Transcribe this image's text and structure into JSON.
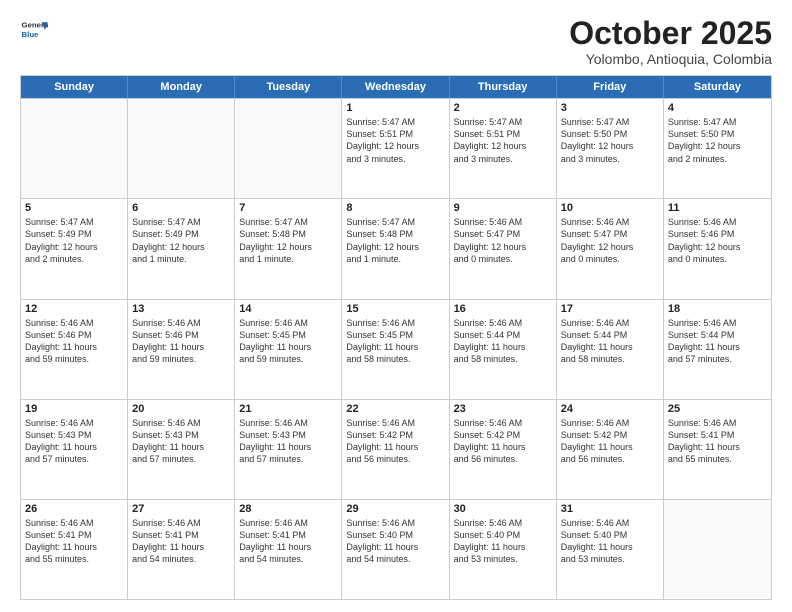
{
  "logo": {
    "general": "General",
    "blue": "Blue"
  },
  "header": {
    "month": "October 2025",
    "location": "Yolombo, Antioquia, Colombia"
  },
  "weekdays": [
    "Sunday",
    "Monday",
    "Tuesday",
    "Wednesday",
    "Thursday",
    "Friday",
    "Saturday"
  ],
  "rows": [
    [
      {
        "day": "",
        "info": ""
      },
      {
        "day": "",
        "info": ""
      },
      {
        "day": "",
        "info": ""
      },
      {
        "day": "1",
        "info": "Sunrise: 5:47 AM\nSunset: 5:51 PM\nDaylight: 12 hours\nand 3 minutes."
      },
      {
        "day": "2",
        "info": "Sunrise: 5:47 AM\nSunset: 5:51 PM\nDaylight: 12 hours\nand 3 minutes."
      },
      {
        "day": "3",
        "info": "Sunrise: 5:47 AM\nSunset: 5:50 PM\nDaylight: 12 hours\nand 3 minutes."
      },
      {
        "day": "4",
        "info": "Sunrise: 5:47 AM\nSunset: 5:50 PM\nDaylight: 12 hours\nand 2 minutes."
      }
    ],
    [
      {
        "day": "5",
        "info": "Sunrise: 5:47 AM\nSunset: 5:49 PM\nDaylight: 12 hours\nand 2 minutes."
      },
      {
        "day": "6",
        "info": "Sunrise: 5:47 AM\nSunset: 5:49 PM\nDaylight: 12 hours\nand 1 minute."
      },
      {
        "day": "7",
        "info": "Sunrise: 5:47 AM\nSunset: 5:48 PM\nDaylight: 12 hours\nand 1 minute."
      },
      {
        "day": "8",
        "info": "Sunrise: 5:47 AM\nSunset: 5:48 PM\nDaylight: 12 hours\nand 1 minute."
      },
      {
        "day": "9",
        "info": "Sunrise: 5:46 AM\nSunset: 5:47 PM\nDaylight: 12 hours\nand 0 minutes."
      },
      {
        "day": "10",
        "info": "Sunrise: 5:46 AM\nSunset: 5:47 PM\nDaylight: 12 hours\nand 0 minutes."
      },
      {
        "day": "11",
        "info": "Sunrise: 5:46 AM\nSunset: 5:46 PM\nDaylight: 12 hours\nand 0 minutes."
      }
    ],
    [
      {
        "day": "12",
        "info": "Sunrise: 5:46 AM\nSunset: 5:46 PM\nDaylight: 11 hours\nand 59 minutes."
      },
      {
        "day": "13",
        "info": "Sunrise: 5:46 AM\nSunset: 5:46 PM\nDaylight: 11 hours\nand 59 minutes."
      },
      {
        "day": "14",
        "info": "Sunrise: 5:46 AM\nSunset: 5:45 PM\nDaylight: 11 hours\nand 59 minutes."
      },
      {
        "day": "15",
        "info": "Sunrise: 5:46 AM\nSunset: 5:45 PM\nDaylight: 11 hours\nand 58 minutes."
      },
      {
        "day": "16",
        "info": "Sunrise: 5:46 AM\nSunset: 5:44 PM\nDaylight: 11 hours\nand 58 minutes."
      },
      {
        "day": "17",
        "info": "Sunrise: 5:46 AM\nSunset: 5:44 PM\nDaylight: 11 hours\nand 58 minutes."
      },
      {
        "day": "18",
        "info": "Sunrise: 5:46 AM\nSunset: 5:44 PM\nDaylight: 11 hours\nand 57 minutes."
      }
    ],
    [
      {
        "day": "19",
        "info": "Sunrise: 5:46 AM\nSunset: 5:43 PM\nDaylight: 11 hours\nand 57 minutes."
      },
      {
        "day": "20",
        "info": "Sunrise: 5:46 AM\nSunset: 5:43 PM\nDaylight: 11 hours\nand 57 minutes."
      },
      {
        "day": "21",
        "info": "Sunrise: 5:46 AM\nSunset: 5:43 PM\nDaylight: 11 hours\nand 57 minutes."
      },
      {
        "day": "22",
        "info": "Sunrise: 5:46 AM\nSunset: 5:42 PM\nDaylight: 11 hours\nand 56 minutes."
      },
      {
        "day": "23",
        "info": "Sunrise: 5:46 AM\nSunset: 5:42 PM\nDaylight: 11 hours\nand 56 minutes."
      },
      {
        "day": "24",
        "info": "Sunrise: 5:46 AM\nSunset: 5:42 PM\nDaylight: 11 hours\nand 56 minutes."
      },
      {
        "day": "25",
        "info": "Sunrise: 5:46 AM\nSunset: 5:41 PM\nDaylight: 11 hours\nand 55 minutes."
      }
    ],
    [
      {
        "day": "26",
        "info": "Sunrise: 5:46 AM\nSunset: 5:41 PM\nDaylight: 11 hours\nand 55 minutes."
      },
      {
        "day": "27",
        "info": "Sunrise: 5:46 AM\nSunset: 5:41 PM\nDaylight: 11 hours\nand 54 minutes."
      },
      {
        "day": "28",
        "info": "Sunrise: 5:46 AM\nSunset: 5:41 PM\nDaylight: 11 hours\nand 54 minutes."
      },
      {
        "day": "29",
        "info": "Sunrise: 5:46 AM\nSunset: 5:40 PM\nDaylight: 11 hours\nand 54 minutes."
      },
      {
        "day": "30",
        "info": "Sunrise: 5:46 AM\nSunset: 5:40 PM\nDaylight: 11 hours\nand 53 minutes."
      },
      {
        "day": "31",
        "info": "Sunrise: 5:46 AM\nSunset: 5:40 PM\nDaylight: 11 hours\nand 53 minutes."
      },
      {
        "day": "",
        "info": ""
      }
    ]
  ]
}
